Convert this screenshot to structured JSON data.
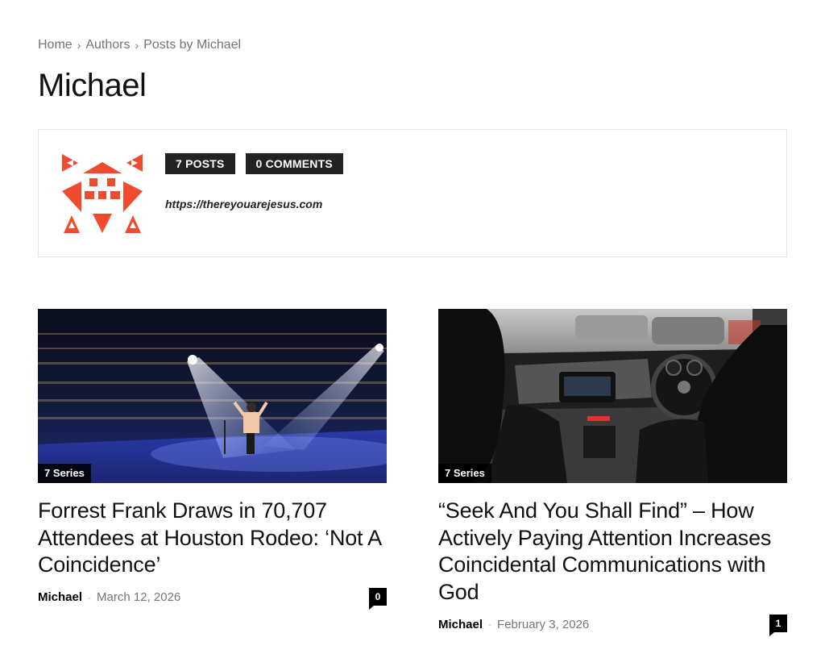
{
  "breadcrumb": {
    "items": [
      "Home",
      "Authors",
      "Posts by Michael"
    ],
    "separator": "›"
  },
  "page": {
    "title": "Michael"
  },
  "author_box": {
    "posts_badge": "7 POSTS",
    "comments_badge": "0 COMMENTS",
    "url": "https://thereyouarejesus.com",
    "avatar_color": "#f04a2f",
    "avatar_icon": "identicon-avatar"
  },
  "posts": [
    {
      "category": "7 Series",
      "title": "Forrest Frank Draws in 70,707 Attendees at Houston Rodeo: ‘Not A Coincidence’",
      "author": "Michael",
      "date": "March 12, 2026",
      "comments": "0"
    },
    {
      "category": "7 Series",
      "title": "“Seek And You Shall Find” – How Actively Paying Attention Increases Coincidental Communications with God",
      "author": "Michael",
      "date": "February 3, 2026",
      "comments": "1"
    }
  ],
  "colors": {
    "accent": "#f04a2f",
    "badge_bg": "#222222",
    "meta_gray": "#767676"
  }
}
